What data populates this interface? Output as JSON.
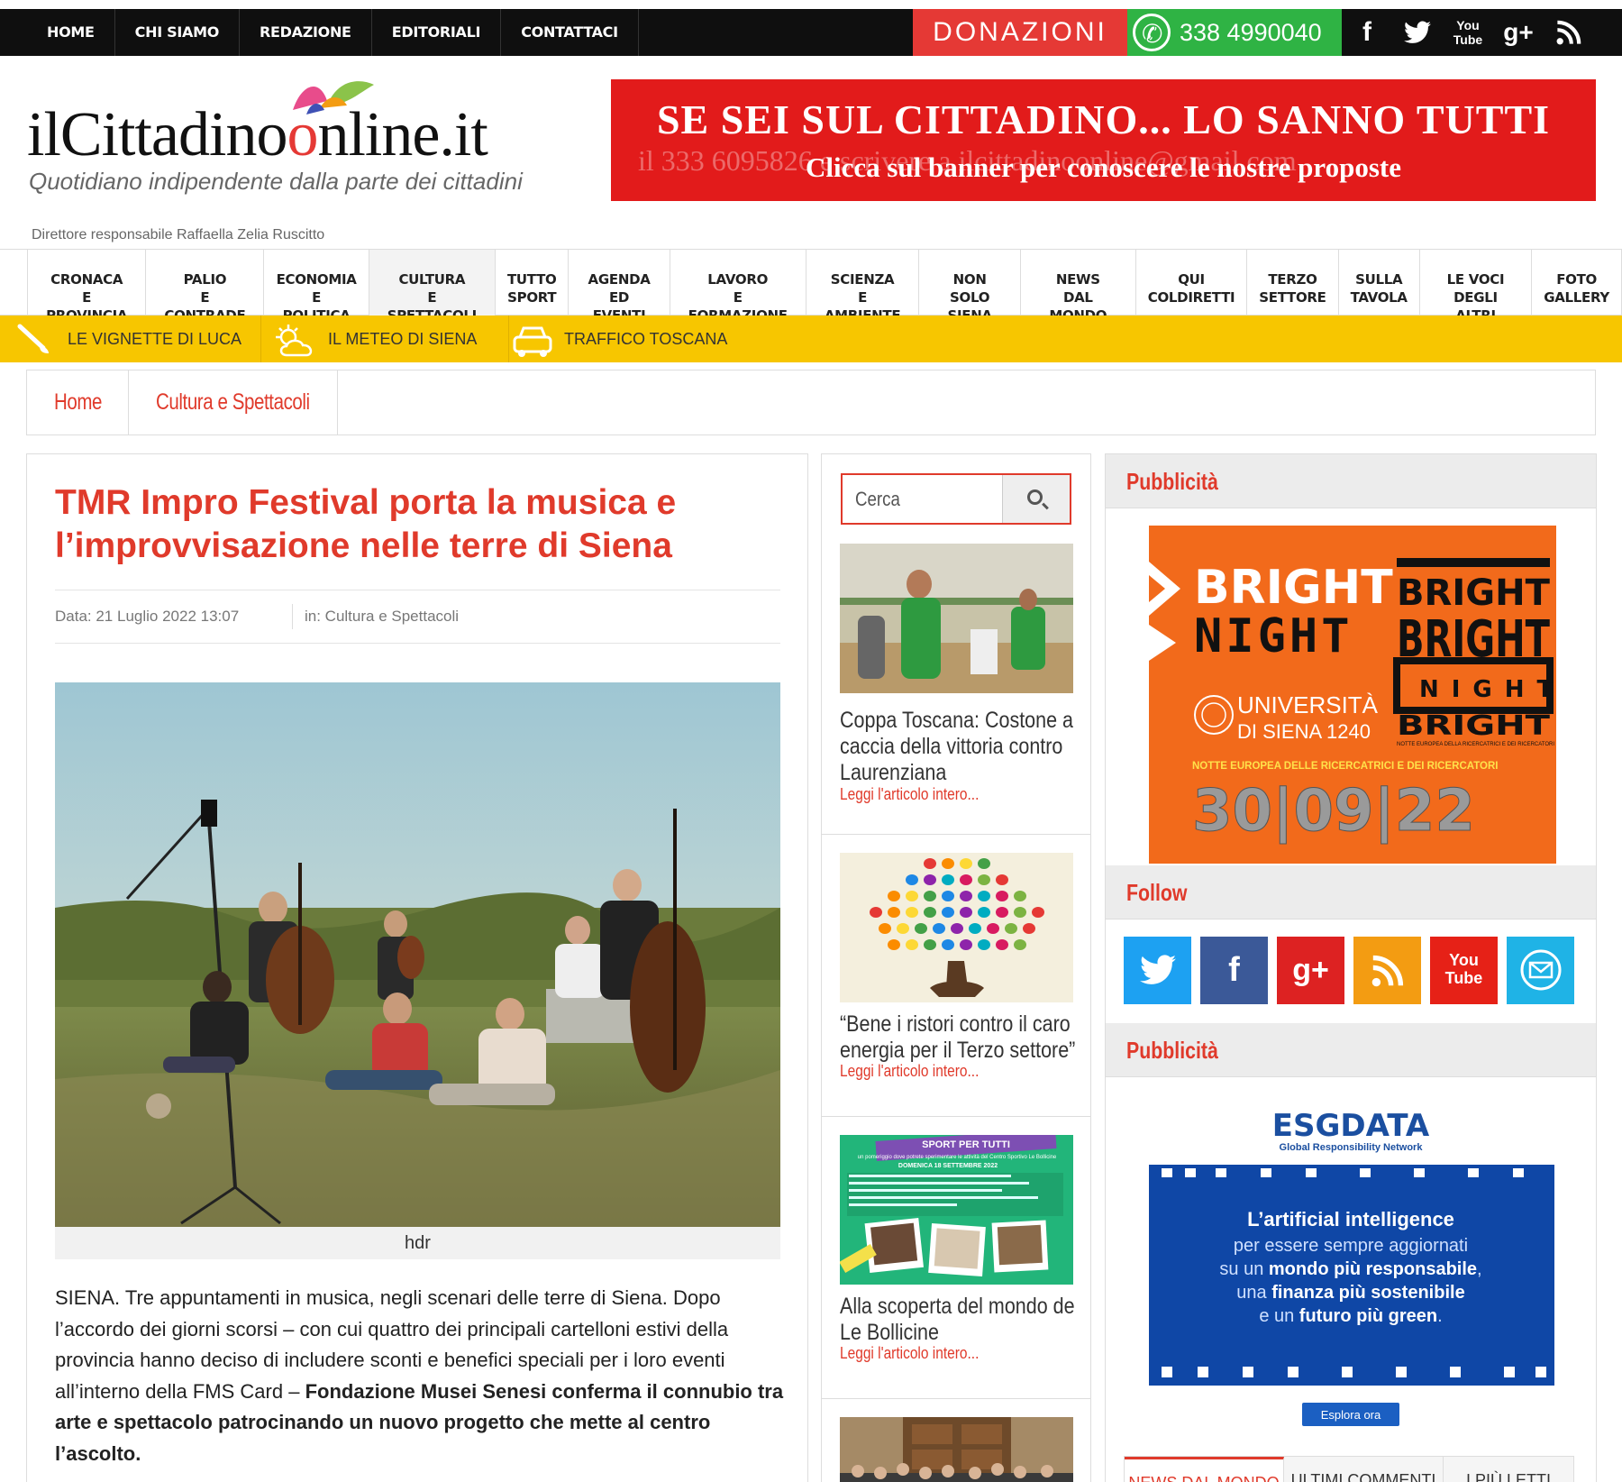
{
  "topnav": {
    "items": [
      "HOME",
      "CHI SIAMO",
      "REDAZIONE",
      "EDITORIALI",
      "CONTATTACI"
    ]
  },
  "donate_label": "DONAZIONI",
  "whatsapp_number": "338 4990040",
  "social_top": [
    "facebook-icon",
    "twitter-icon",
    "youtube-icon",
    "googleplus-icon",
    "rss-icon"
  ],
  "logo": {
    "name_part1": "ilCittadino",
    "name_o": "o",
    "name_part2": "nline.it",
    "tagline": "Quotidiano indipendente dalla parte dei cittadini"
  },
  "director": "Direttore responsabile Raffaella Zelia Ruscitto",
  "banner": {
    "line1": "SE SEI SUL CITTADINO... LO SANNO TUTTI",
    "line2": "Clicca sul banner per conoscere le nostre proposte",
    "ghost": "il 333 6095826 e scrivere a ilcittadinoonline@gmail.com"
  },
  "mainnav": [
    {
      "l1": "CRONACA",
      "l2": "E PROVINCIA"
    },
    {
      "l1": "PALIO",
      "l2": "E CONTRADE"
    },
    {
      "l1": "ECONOMIA",
      "l2": "E POLITICA"
    },
    {
      "l1": "CULTURA",
      "l2": "E SPETTACOLI"
    },
    {
      "l1": "TUTTO",
      "l2": "SPORT"
    },
    {
      "l1": "AGENDA",
      "l2": "ED EVENTI"
    },
    {
      "l1": "LAVORO",
      "l2": "E FORMAZIONE"
    },
    {
      "l1": "SCIENZA",
      "l2": "E AMBIENTE"
    },
    {
      "l1": "NON SOLO",
      "l2": "SIENA"
    },
    {
      "l1": "NEWS",
      "l2": "DAL MONDO"
    },
    {
      "l1": "QUI",
      "l2": "COLDIRETTI"
    },
    {
      "l1": "TERZO",
      "l2": "SETTORE"
    },
    {
      "l1": "SULLA",
      "l2": "TAVOLA"
    },
    {
      "l1": "LE VOCI",
      "l2": "DEGLI ALTRI"
    },
    {
      "l1": "FOTO",
      "l2": "GALLERY"
    }
  ],
  "yellowbar": [
    "LE VIGNETTE DI LUCA",
    "IL METEO DI SIENA",
    "TRAFFICO TOSCANA"
  ],
  "breadcrumb": [
    "Home",
    "Cultura e Spettacoli"
  ],
  "article": {
    "title": "TMR Impro Festival porta la musica e l’improvvisazione nelle terre di Siena",
    "date": "Data: 21 Luglio 2022 13:07",
    "category": "in: Cultura e Spettacoli",
    "caption": "hdr",
    "body_plain": "SIENA. Tre appuntamenti in musica, negli scenari delle terre di Siena. Dopo l’accordo dei giorni scorsi – con cui quattro dei principali cartelloni estivi della provincia hanno deciso di includere sconti e benefici speciali per i loro eventi all’interno della FMS Card – ",
    "body_bold": "Fondazione Musei Senesi conferma il connubio tra arte e spettacolo patrocinando un nuovo progetto che mette al centro l’ascolto."
  },
  "search": {
    "placeholder": "Cerca"
  },
  "sidebar_news": [
    {
      "title": "Coppa Toscana: Costone a caccia della vittoria contro Laurenziana",
      "more": "Leggi l'articolo intero..."
    },
    {
      "title": "“Bene i ristori contro il caro energia per il Terzo settore”",
      "more": "Leggi l'articolo intero..."
    },
    {
      "title": "Alla scoperta del mondo de Le Bollicine",
      "more": "Leggi l'articolo intero..."
    }
  ],
  "news3_thumb": {
    "header": "SPORT PER TUTTI",
    "sub": "un pomeriggio dove potrete sperimentare le attività del Centro Sportivo Le Bollicine",
    "date": "DOMENICA 18 SETTEMBRE 2022"
  },
  "widgets": {
    "pubblicita": "Pubblicità",
    "follow": "Follow"
  },
  "ad1": {
    "bright": "BRIGHT",
    "night": "NIGHT",
    "uni1": "UNIVERSITÀ",
    "uni2": "DI SIENA 1240",
    "notte": "NOTTE EUROPEA DELLE RICERCATRICI E DEI RICERCATORI",
    "date": "30|09|22",
    "right_big": "BRIGHT",
    "right_small": "NIGHT",
    "right_fine": "NOTTE EUROPEA DELLA RICERCATRICI E DEI RICERCATORI"
  },
  "follow_icons": [
    {
      "name": "twitter",
      "color": "#1da1f2",
      "glyph": "🐦"
    },
    {
      "name": "facebook",
      "color": "#3b5998",
      "glyph": "f"
    },
    {
      "name": "googleplus",
      "color": "#dd2222",
      "glyph": "g+"
    },
    {
      "name": "rss",
      "color": "#f39c12",
      "glyph": "◔"
    },
    {
      "name": "youtube",
      "color": "#e62117",
      "glyph": "▶"
    },
    {
      "name": "email",
      "color": "#1fb3e6",
      "glyph": "✉"
    }
  ],
  "ad2": {
    "brand": "ESGDATA",
    "sub": "Global Responsibility Network",
    "t1": "L’artificial intelligence",
    "t2": "per essere sempre aggiornati",
    "t3a": "su un ",
    "t3b": "mondo più responsabile",
    "t3c": ",",
    "t4a": "una ",
    "t4b": "finanza più sostenibile",
    "t5a": "e un ",
    "t5b": "futuro più green",
    "t5c": ".",
    "cta": "Esplora ora"
  },
  "tabs": [
    "NEWS DAL MONDO",
    "ULTIMI COMMENTI",
    "I PIÙ LETTI"
  ]
}
